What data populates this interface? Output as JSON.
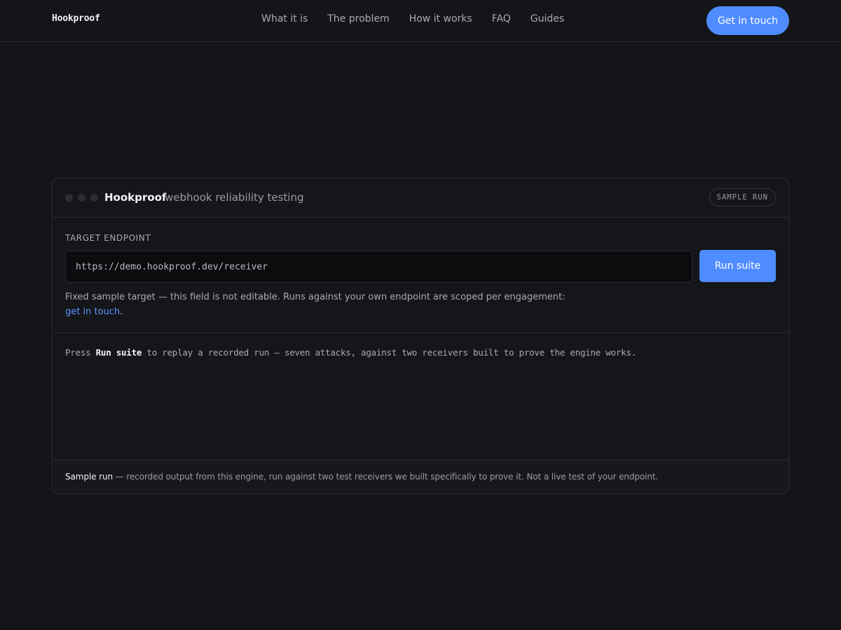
{
  "header": {
    "brand": "Hookproof",
    "nav": [
      "What it is",
      "The problem",
      "How it works",
      "FAQ",
      "Guides"
    ],
    "cta_label": "Get in touch"
  },
  "card": {
    "title": "Hookproof",
    "subtitle": "webhook reliability testing",
    "badge": "SAMPLE RUN",
    "target_label": "TARGET ENDPOINT",
    "target_value": "https://demo.hookproof.dev/receiver",
    "run_label": "Run suite",
    "note_text": "Fixed sample target — this field is not editable. Runs against your own endpoint are scoped per engagement:",
    "note_link": "get in touch",
    "note_end": ".",
    "console_prefix": "Press ",
    "console_emphasis": "Run suite",
    "console_suffix": " to replay a recorded run — seven attacks, against two receivers built to prove the engine works.",
    "footer_emphasis": "Sample run",
    "footer_text": " — recorded output from this engine, run against two test receivers we built specifically to prove it. Not a live test of your endpoint."
  }
}
